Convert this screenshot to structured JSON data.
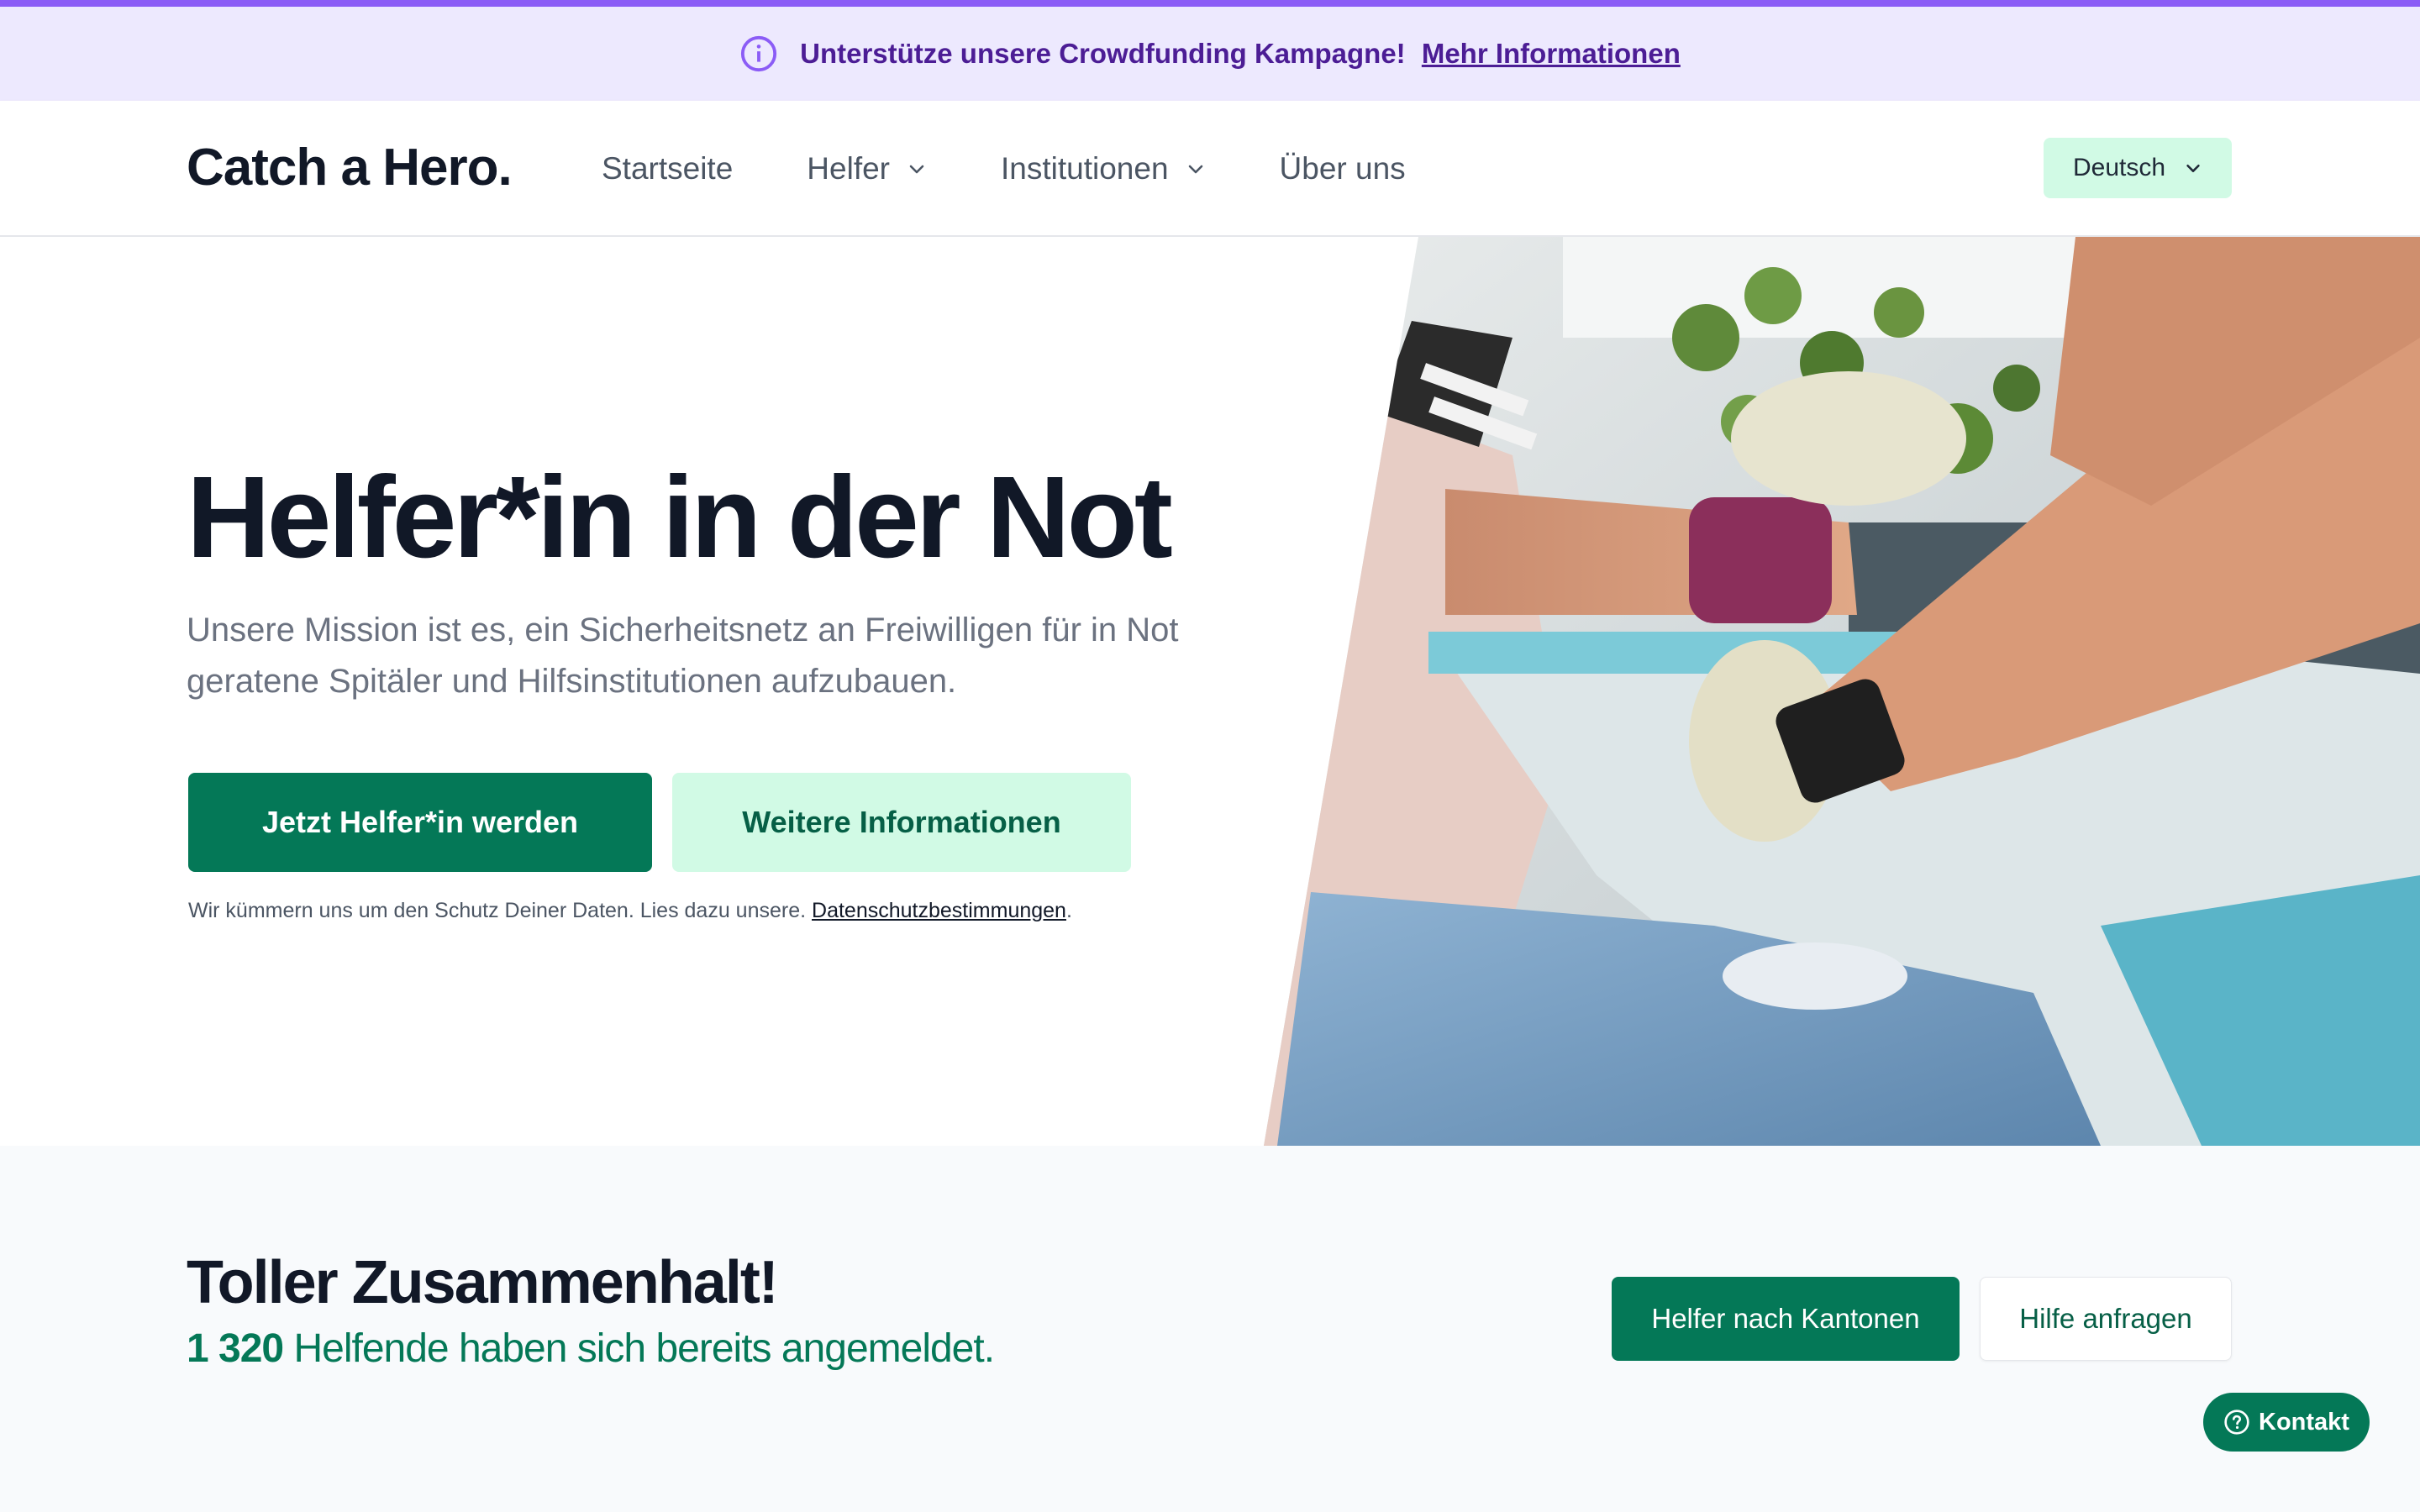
{
  "announcement": {
    "text": "Unterstütze unsere Crowdfunding Kampagne!",
    "link": "Mehr Informationen",
    "icon": "info-circle-icon"
  },
  "header": {
    "logo": "Catch a Hero.",
    "nav": [
      {
        "label": "Startseite",
        "dropdown": false
      },
      {
        "label": "Helfer",
        "dropdown": true
      },
      {
        "label": "Institutionen",
        "dropdown": true
      },
      {
        "label": "Über uns",
        "dropdown": false
      }
    ],
    "language": "Deutsch"
  },
  "hero": {
    "title": "Helfer*in in der Not",
    "subtitle": "Unsere Mission ist es, ein Sicherheitsnetz an Freiwilligen für in Not geratene Spitäler und Hilfsinstitutionen aufzubauen.",
    "primary_button": "Jetzt Helfer*in werden",
    "secondary_button": "Weitere Informationen",
    "privacy_text": "Wir kümmern uns um den Schutz Deiner Daten. Lies dazu unsere.",
    "privacy_link": "Datenschutzbestimmungen",
    "privacy_suffix": "."
  },
  "stats": {
    "title": "Toller Zusammenhalt!",
    "count": "1 320",
    "count_text": "Helfende haben sich bereits angemeldet.",
    "button_cantons": "Helfer nach Kantonen",
    "button_help": "Hilfe anfragen"
  },
  "contact_widget": {
    "label": "Kontakt",
    "icon": "question-circle-icon"
  },
  "colors": {
    "accent_green": "#047857",
    "light_green": "#d1fae5",
    "announcement_bg": "#ede9fe",
    "announcement_text": "#4c1d95",
    "announcement_border": "#8b5cf6"
  }
}
